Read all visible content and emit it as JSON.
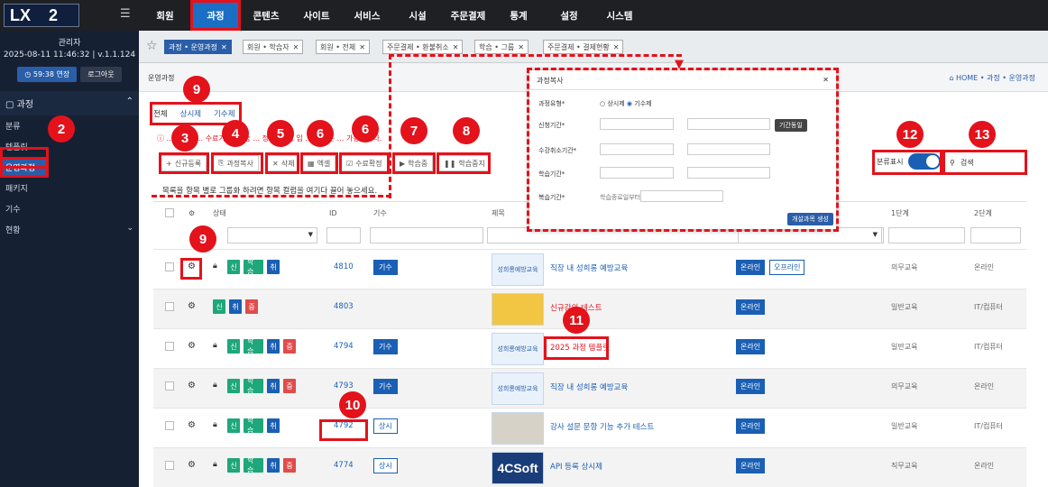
{
  "topbar": {
    "logo_left": "LX",
    "logo_right": "2",
    "menu": [
      "회원",
      "과정",
      "콘텐츠",
      "사이트",
      "서비스",
      "시설",
      "주문결제",
      "통계",
      "설정",
      "시스템"
    ]
  },
  "sidebar": {
    "user": "관리자",
    "datetime": "2025-08-11 11:46:32",
    "version": "v.1.1.124",
    "extend_btn": "59:38 연장",
    "logout_btn": "로그아웃",
    "section": "과정",
    "items": [
      "분류",
      "템플릿",
      "운영과정",
      "패키지",
      "기수",
      "현황"
    ]
  },
  "tabs": [
    {
      "label": "과정 • 운영과정"
    },
    {
      "label": "회원 • 학습자"
    },
    {
      "label": "회원 • 전체"
    },
    {
      "label": "주문결제 • 환불취소"
    },
    {
      "label": "학습 • 그룹"
    },
    {
      "label": "주문결제 • 결제현황"
    }
  ],
  "page": {
    "title": "운영과정",
    "breadcrumb": "HOME • 과정 • 운영과정"
  },
  "subtabs": [
    "전체",
    "상시제",
    "기수제"
  ],
  "alert": "…간벽인 … 수료기 … 학습 … 정되 … 정 입 … 과정은 … 가능합니다.",
  "toolbar": [
    "신규등록",
    "과정복사",
    "삭제",
    "엑셀",
    "수료확정",
    "학습중",
    "학습중지"
  ],
  "grouphint": "목록을 항목 별로 그룹화 하려면 항목 컬럼을 여기다 끌어 놓으세요.",
  "columns": [
    "상태",
    "ID",
    "기수",
    "제목",
    "1단계",
    "2단계"
  ],
  "toggle_label": "분류표시",
  "search_placeholder": "검색",
  "rows": [
    {
      "id": "4810",
      "type": "기수",
      "title": "직장 내 성희롱 예방교육",
      "mode": [
        "온라인",
        "오프라인"
      ],
      "lv1": "의무교육",
      "lv2": "온라인",
      "chips": [
        [
          "신",
          "g"
        ],
        [
          "학습",
          "g"
        ],
        [
          "취",
          "b"
        ]
      ],
      "thumb": "성희롱예방교육",
      "thumbtype": ""
    },
    {
      "id": "4803",
      "type": "",
      "title": "신규강의 테스트",
      "mode": [
        "온라인"
      ],
      "lv1": "일반교육",
      "lv2": "IT/컴퓨터",
      "chips": [
        [
          "신",
          "g"
        ],
        [
          "취",
          "b"
        ],
        [
          "중",
          "r"
        ]
      ],
      "thumb": "",
      "thumbtype": "yellow"
    },
    {
      "id": "4794",
      "type": "기수",
      "title": "2025 과정 템플릿",
      "mode": [
        "온라인"
      ],
      "lv1": "일반교육",
      "lv2": "IT/컴퓨터",
      "chips": [
        [
          "신",
          "g"
        ],
        [
          "학습",
          "g"
        ],
        [
          "취",
          "b"
        ],
        [
          "중",
          "r"
        ]
      ],
      "thumb": "성희롱예방교육",
      "thumbtype": ""
    },
    {
      "id": "4793",
      "type": "기수",
      "title": "직장 내 성희롱 예방교육",
      "mode": [
        "온라인"
      ],
      "lv1": "의무교육",
      "lv2": "온라인",
      "chips": [
        [
          "신",
          "g"
        ],
        [
          "학습",
          "g"
        ],
        [
          "취",
          "b"
        ],
        [
          "중",
          "r"
        ]
      ],
      "thumb": "성희롱예방교육",
      "thumbtype": ""
    },
    {
      "id": "4792",
      "type": "상시",
      "title": "강사 설문 문항 기능 추가 테스트",
      "mode": [
        "온라인"
      ],
      "lv1": "일반교육",
      "lv2": "IT/컴퓨터",
      "chips": [
        [
          "신",
          "g"
        ],
        [
          "학습",
          "g"
        ],
        [
          "취",
          "b"
        ]
      ],
      "thumb": "",
      "thumbtype": "photo"
    },
    {
      "id": "4774",
      "type": "상시",
      "title": "API 등록 상시제",
      "mode": [
        "온라인"
      ],
      "lv1": "직무교육",
      "lv2": "온라인",
      "chips": [
        [
          "신",
          "g"
        ],
        [
          "학습",
          "g"
        ],
        [
          "취",
          "b"
        ],
        [
          "중",
          "r"
        ]
      ],
      "thumb": "4CSoft",
      "thumbtype": "logo4c"
    }
  ],
  "modal": {
    "title": "과정복사",
    "fields": [
      "과정유형*",
      "신청기간*",
      "수강취소기간*",
      "학습기간*",
      "복습기간*"
    ],
    "type_options": [
      "상시제",
      "기수제"
    ],
    "period_btn": "기간동일",
    "review_text": "학습종료일부터",
    "create_btn": "개설과목 생성"
  },
  "badges": [
    "9",
    "2",
    "3",
    "4",
    "5",
    "6",
    "6",
    "7",
    "8",
    "9",
    "10",
    "11",
    "12",
    "13"
  ]
}
